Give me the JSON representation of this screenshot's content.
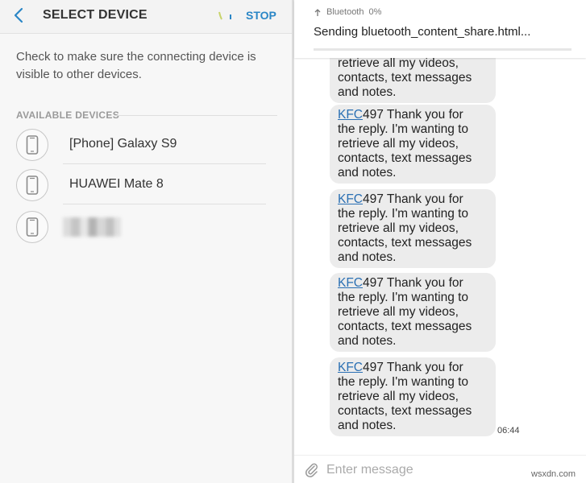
{
  "left": {
    "title": "SELECT DEVICE",
    "stop_label": "STOP",
    "info": "Check to make sure the connecting device is visible to other devices.",
    "section_label": "AVAILABLE DEVICES",
    "devices": [
      {
        "name": "[Phone] Galaxy S9",
        "icon": "phone-icon"
      },
      {
        "name": "HUAWEI Mate 8",
        "icon": "phone-icon"
      },
      {
        "name": "",
        "icon": "phone-icon",
        "blurred": true
      }
    ]
  },
  "right": {
    "notification": {
      "app": "Bluetooth",
      "percent": "0%",
      "text": "Sending bluetooth_content_share.html...",
      "progress": 0.0
    },
    "partial_message": {
      "line1": "retrieve all my videos,",
      "line2": "contacts, text messages",
      "line3": "and notes."
    },
    "messages": [
      {
        "link": "KFC",
        "rest1": "497 Thank you for",
        "l2": "the reply. I'm wanting to",
        "l3": "retrieve all my videos,",
        "l4": "contacts, text messages",
        "l5": "and notes."
      },
      {
        "link": "KFC",
        "rest1": "497 Thank you for",
        "l2": "the reply. I'm wanting to",
        "l3": "retrieve all my videos,",
        "l4": "contacts, text messages",
        "l5": "and notes."
      },
      {
        "link": "KFC",
        "rest1": "497 Thank you for",
        "l2": "the reply. I'm wanting to",
        "l3": "retrieve all my videos,",
        "l4": "contacts, text messages",
        "l5": "and notes."
      },
      {
        "link": "KFC",
        "rest1": "497 Thank you for",
        "l2": "the reply. I'm wanting to",
        "l3": "retrieve all my videos,",
        "l4": "contacts, text messages",
        "l5": "and notes."
      }
    ],
    "time": "06:44",
    "input_placeholder": "Enter message"
  },
  "watermark": "wsxdn.com",
  "colors": {
    "accent": "#2a86c6",
    "bubble": "#ececec",
    "link": "#2a6fb3"
  }
}
